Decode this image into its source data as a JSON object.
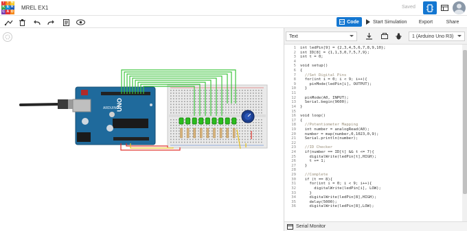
{
  "header": {
    "logo_letters": [
      "TIN",
      "KER",
      "CAD"
    ],
    "logo_colors": [
      "#e3342f",
      "#f58b1f",
      "#f5c518",
      "#3fa34d",
      "#1a8fd6",
      "#1e5bb8",
      "#7b3fb3",
      "#e3342f",
      "#f58b1f"
    ],
    "design_title": "MREL EX1",
    "saved_label": "Saved"
  },
  "toolbar": {
    "code_label": "Code",
    "start_sim_label": "Start Simulation",
    "export_label": "Export",
    "share_label": "Share"
  },
  "code_panel": {
    "mode_select": "Text",
    "device_select": "1 (Arduino Uno R3)",
    "serial_monitor_label": "Serial Monitor",
    "code_lines": [
      "int ledPin[9] = {2,3,4,5,6,7,8,9,10};",
      "int ID[8] = {1,1,3,0,7,5,7,9};",
      "int t = 0;",
      "",
      "void setup()",
      "{",
      "  //Set Digital Pins",
      "  for(int i = 0; i < 9; i++){",
      "    pinMode(ledPin[i], OUTPUT);",
      "  }",
      "",
      "  pinMode(A0, INPUT);",
      "  Serial.begin(9600);",
      "}",
      "",
      "void loop()",
      "{",
      "  //Potentiometer Mapping",
      "  int number = analogRead(A0);",
      "  number = map(number,0,1023,0,9);",
      "  Serial.println(number);",
      "",
      "  //ID Checker",
      "  if(number == ID[t] && t <= 7){",
      "    digitalWrite(ledPin[t],HIGH);",
      "    t += 1;",
      "  }",
      "",
      "  //Complete",
      "  if (t == 8){",
      "    for(int i = 0; i < 9; i++){",
      "      digitalWrite(ledPin[i], LOW);",
      "    }",
      "    digitalWrite(ledPin[8],HIGH);",
      "    delay(5000);",
      "    digitalWrite(ledPin[8],LOW);"
    ]
  },
  "board": {
    "brand": "ARDUINO",
    "model": "UNO"
  },
  "colors": {
    "accent": "#1477d1",
    "board": "#1f6a9c",
    "led": "#2bbd1e",
    "wire_green": "#3cc43c",
    "wire_red": "#e0302a",
    "wire_yellow": "#e8c11a"
  }
}
